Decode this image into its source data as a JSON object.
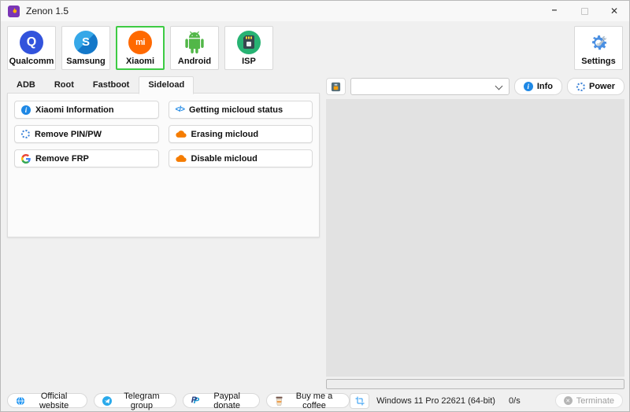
{
  "window": {
    "title": "Zenon 1.5",
    "app_icon": "flame-icon",
    "controls": {
      "minimize": "–",
      "maximize": "maximize-box",
      "close": "✕"
    }
  },
  "toolbar": {
    "selected_brand": "Xiaomi",
    "brands": [
      {
        "label": "Qualcomm",
        "icon": "qualcomm-icon",
        "glyph": "Q",
        "selected": false
      },
      {
        "label": "Samsung",
        "icon": "samsung-icon",
        "glyph": "S",
        "selected": false
      },
      {
        "label": "Xiaomi",
        "icon": "xiaomi-icon",
        "glyph": "mi",
        "selected": true
      },
      {
        "label": "Android",
        "icon": "android-icon",
        "glyph": "",
        "selected": false
      },
      {
        "label": "ISP",
        "icon": "isp-icon",
        "glyph": "",
        "selected": false
      }
    ],
    "settings_label": "Settings"
  },
  "tabs": {
    "active": "Sideload",
    "items": [
      {
        "label": "ADB"
      },
      {
        "label": "Root"
      },
      {
        "label": "Fastboot"
      },
      {
        "label": "Sideload"
      }
    ]
  },
  "actions_left": [
    {
      "label": "Xiaomi Information",
      "icon": "info-icon"
    },
    {
      "label": "Remove PIN/PW",
      "icon": "spinner-icon"
    },
    {
      "label": "Remove FRP",
      "icon": "google-icon"
    }
  ],
  "actions_right": [
    {
      "label": "Getting micloud status",
      "icon": "code-icon"
    },
    {
      "label": "Erasing micloud",
      "icon": "cloud-icon"
    },
    {
      "label": "Disable micloud",
      "icon": "cloud-icon"
    }
  ],
  "device_bar": {
    "device_button_icon": "device-icon",
    "combo_value": "",
    "info_label": "Info",
    "power_label": "Power"
  },
  "glyphs": {
    "code": "</>",
    "info_i": "i"
  },
  "statusbar": {
    "links": [
      {
        "label": "Official website",
        "icon": "globe-icon"
      },
      {
        "label": "Telegram group",
        "icon": "telegram-icon"
      },
      {
        "label": "Paypal donate",
        "icon": "paypal-icon"
      },
      {
        "label": "Buy me a coffee",
        "icon": "coffee-icon"
      }
    ],
    "screenshot_button_icon": "crop-icon",
    "os": "Windows 11 Pro 22621 (64-bit)",
    "speed": "0/s",
    "terminate_label": "Terminate"
  },
  "colors": {
    "selected_border": "#3ecb44",
    "xiaomi_orange": "#ff6900",
    "accent_blue": "#1e88e5",
    "cloud_orange": "#f57c00",
    "log_background": "#e2e2e2",
    "terminate_disabled": "#9e9e9e"
  }
}
